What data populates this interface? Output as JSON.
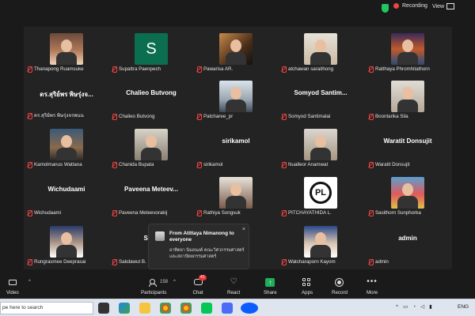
{
  "topbar": {
    "recording_label": "Recording",
    "view_label": "View",
    "colors": {
      "shield": "#22c55e",
      "record": "#ef4444"
    }
  },
  "gallery": {
    "tiles": [
      {
        "name": "Thanapong Ruamsuke",
        "display": "",
        "thumb": "ph1"
      },
      {
        "name": "Supattra Paenpech",
        "display": "",
        "avatar_letter": "S"
      },
      {
        "name": "Pawarisa AR.",
        "display": "",
        "thumb": "ph2"
      },
      {
        "name": "atchawan saraithong",
        "display": "",
        "thumb": "ph3"
      },
      {
        "name": "Ratthaya Phromhitathorn",
        "display": "",
        "thumb": "ph4"
      },
      {
        "name": "ดร.สุริย์พร พิษรุ่งจรพนน",
        "display": "ดร.สุริย์พร พิษรุ่งจ..."
      },
      {
        "name": "Chalieo Butvong",
        "display": "Chalieo Butvong"
      },
      {
        "name": "Patcharee_pr",
        "display": "",
        "thumb": "ph5"
      },
      {
        "name": "Somyod Santimalai",
        "display": "Somyod  Santim..."
      },
      {
        "name": "Boontarika Sila",
        "display": "",
        "thumb": "ph6"
      },
      {
        "name": "Kamolmanus Wattana",
        "display": "",
        "thumb": "ph7"
      },
      {
        "name": "Chanida Bupata",
        "display": "",
        "thumb": "ph8"
      },
      {
        "name": "sirikamol",
        "display": "sirikamol"
      },
      {
        "name": "Nualleor Anamwat",
        "display": "",
        "thumb": "ph9"
      },
      {
        "name": "Waratit Donsujit",
        "display": "Waratit Donsujit"
      },
      {
        "name": "Wichudaami",
        "display": "Wichudaami"
      },
      {
        "name": "Paveena Meteevorakij",
        "display": "Paveena  Meteev..."
      },
      {
        "name": "Rathiya Songsuk",
        "display": "",
        "thumb": "ph10"
      },
      {
        "name": "PITCHAYATHIDA L.",
        "display": "",
        "logo": "PL"
      },
      {
        "name": "Sasithorn Sunphorka",
        "display": "",
        "thumb": "ph11"
      },
      {
        "name": "Rungrasmee Deeprasai",
        "display": "",
        "thumb": "ph12"
      },
      {
        "name": "Sakdawut B.",
        "display": "Sakd"
      },
      {
        "name": "",
        "display": ""
      },
      {
        "name": "Watcharaporn Kayom",
        "display": "",
        "thumb": "ph13"
      },
      {
        "name": "admin",
        "display": "admin"
      }
    ]
  },
  "chat_popup": {
    "title": "From Atittaya Nimanong to everyone",
    "message": "อาทิตยา นิมอนงค์  คณะวิศวกรรมศาสตร์และสถาปัตยกรรมศาสตร์",
    "close": "×"
  },
  "toolbar": {
    "video": "Video",
    "participants": "Participants",
    "participants_count": "158",
    "chat": "Chat",
    "chat_badge": "41",
    "react": "React",
    "share": "Share",
    "apps": "Apps",
    "record": "Record",
    "more": "More",
    "share_color": "#1fae5b"
  },
  "taskbar": {
    "search_placeholder": "pe here to search",
    "lang": "ENG"
  }
}
